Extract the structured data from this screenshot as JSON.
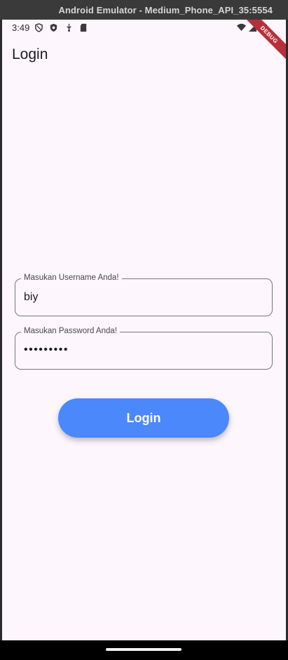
{
  "window": {
    "title": "Android Emulator - Medium_Phone_API_35:5554"
  },
  "status_bar": {
    "time": "3:49",
    "left_icons": [
      "shield-outline-icon",
      "shield-filled-icon",
      "usb-icon",
      "sd-card-icon"
    ],
    "right_icons": [
      "wifi-icon",
      "signal-icon",
      "battery-icon"
    ]
  },
  "debug_banner": {
    "label": "DEBUG"
  },
  "app_bar": {
    "title": "Login"
  },
  "form": {
    "username": {
      "label": "Masukan Username Anda!",
      "value": "biy"
    },
    "password": {
      "label": "Masukan Password Anda!",
      "value": "•••••••••"
    },
    "submit_label": "Login"
  },
  "colors": {
    "background": "#fdf6fd",
    "button": "#4a88fc",
    "debug_ribbon": "#b6303a"
  }
}
